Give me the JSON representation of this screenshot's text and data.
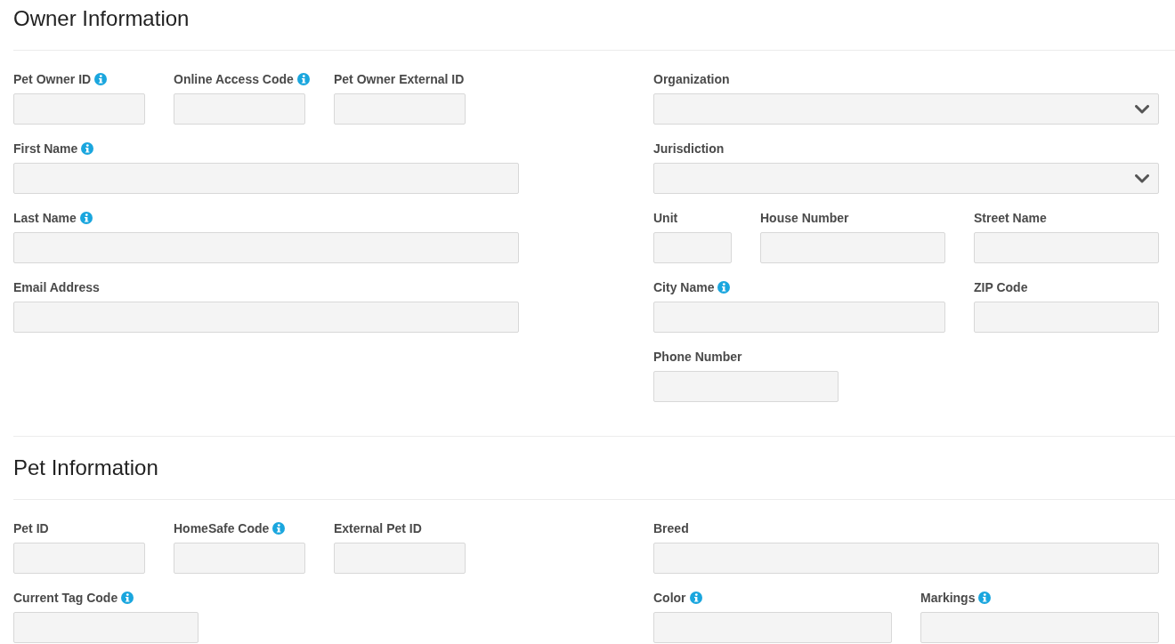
{
  "sections": [
    {
      "title": "Owner Information",
      "left_rows": [
        [
          {
            "label": "Pet Owner ID",
            "info": true,
            "kind": "text"
          },
          {
            "label": "Online Access Code",
            "info": true,
            "kind": "text"
          },
          {
            "label": "Pet Owner External ID",
            "info": false,
            "kind": "text"
          }
        ],
        [
          {
            "label": "First Name",
            "info": true,
            "kind": "text"
          }
        ],
        [
          {
            "label": "Last Name",
            "info": true,
            "kind": "text"
          }
        ],
        [
          {
            "label": "Email Address",
            "info": false,
            "kind": "text"
          }
        ]
      ],
      "right_rows": [
        [
          {
            "label": "Organization",
            "info": false,
            "kind": "select"
          }
        ],
        [
          {
            "label": "Jurisdiction",
            "info": false,
            "kind": "select"
          }
        ],
        [
          {
            "label": "Unit",
            "info": false,
            "kind": "text"
          },
          {
            "label": "House Number",
            "info": false,
            "kind": "text"
          },
          {
            "label": "Street Name",
            "info": false,
            "kind": "text"
          }
        ],
        [
          {
            "label": "City Name",
            "info": true,
            "kind": "text"
          },
          {
            "label": "ZIP Code",
            "info": false,
            "kind": "text"
          }
        ],
        [
          {
            "label": "Phone Number",
            "info": false,
            "kind": "text"
          }
        ]
      ]
    },
    {
      "title": "Pet Information",
      "left_rows": [
        [
          {
            "label": "Pet ID",
            "info": false,
            "kind": "text"
          },
          {
            "label": "HomeSafe Code",
            "info": true,
            "kind": "text"
          },
          {
            "label": "External Pet ID",
            "info": false,
            "kind": "text"
          }
        ],
        [
          {
            "label": "Current Tag Code",
            "info": true,
            "kind": "text"
          }
        ]
      ],
      "right_rows": [
        [
          {
            "label": "Breed",
            "info": false,
            "kind": "text"
          }
        ],
        [
          {
            "label": "Color",
            "info": true,
            "kind": "text"
          },
          {
            "label": "Markings",
            "info": true,
            "kind": "text"
          }
        ]
      ]
    }
  ]
}
